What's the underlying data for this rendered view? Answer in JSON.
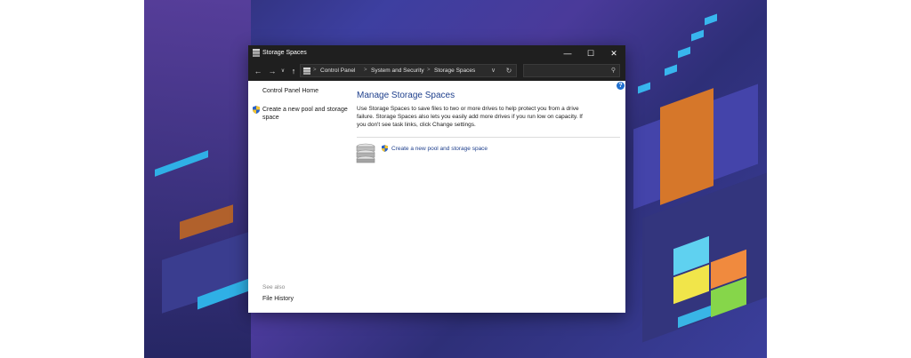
{
  "window": {
    "title": "Storage Spaces",
    "controls": {
      "minimize": "—",
      "maximize": "☐",
      "close": "✕"
    }
  },
  "navigation": {
    "back": "←",
    "forward": "→",
    "history_dropdown": "∨",
    "up": "↑",
    "breadcrumbs": [
      "Control Panel",
      "System and Security",
      "Storage Spaces"
    ],
    "separator": ">",
    "address_dropdown": "∨",
    "refresh": "↻",
    "search_placeholder": "",
    "search_icon": "⚲"
  },
  "left_pane": {
    "home": "Control Panel Home",
    "create_task": "Create a new pool and storage space",
    "see_also_label": "See also",
    "see_also_items": [
      "File History"
    ]
  },
  "main": {
    "help": "?",
    "heading": "Manage Storage Spaces",
    "description": "Use Storage Spaces to save files to two or more drives to help protect you from a drive failure. Storage Spaces also lets you easily add more drives if you run low on capacity. If you don't see task links, click Change settings.",
    "task_link": "Create a new pool and storage space"
  },
  "colors": {
    "titlebar": "#1f1f1f",
    "link": "#1e3f8c",
    "help_badge": "#1f6fcf"
  }
}
